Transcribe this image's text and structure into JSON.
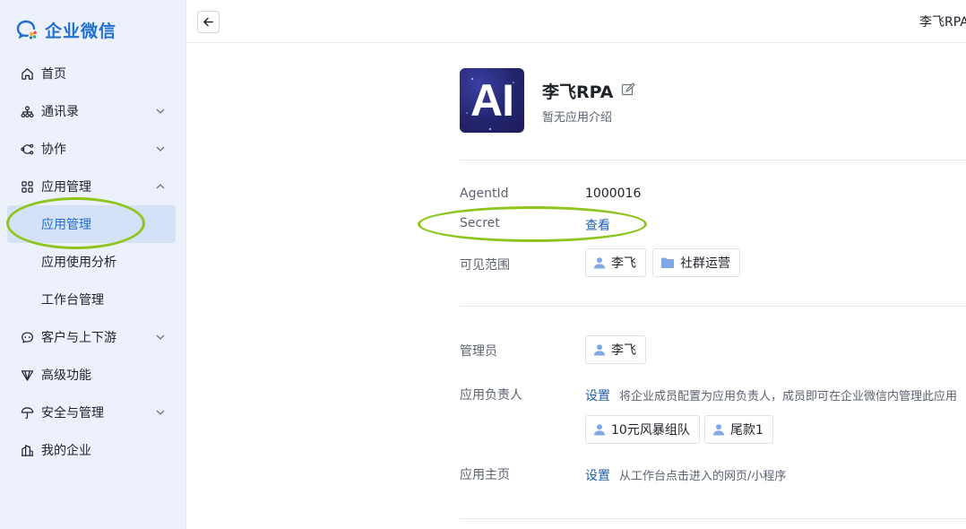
{
  "brand": {
    "name": "企业微信"
  },
  "sidebar": {
    "items": [
      {
        "label": "首页"
      },
      {
        "label": "通讯录"
      },
      {
        "label": "协作"
      },
      {
        "label": "应用管理"
      },
      {
        "label": "客户与上下游"
      },
      {
        "label": "高级功能"
      },
      {
        "label": "安全与管理"
      },
      {
        "label": "我的企业"
      }
    ],
    "subitems": [
      {
        "label": "应用管理"
      },
      {
        "label": "应用使用分析"
      },
      {
        "label": "工作台管理"
      }
    ]
  },
  "header": {
    "title": "李飞RPA"
  },
  "app": {
    "icon_text": "AI",
    "name": "李飞RPA",
    "description": "暂无应用介绍"
  },
  "details": {
    "agentid_label": "AgentId",
    "agentid_value": "1000016",
    "secret_label": "Secret",
    "secret_link": "查看",
    "visibility_label": "可见范围",
    "visibility_tags": [
      {
        "label": "李飞"
      },
      {
        "label": "社群运营"
      }
    ]
  },
  "management": {
    "admin_label": "管理员",
    "admin_tags": [
      {
        "label": "李飞"
      }
    ],
    "owner_label": "应用负责人",
    "owner_link": "设置",
    "owner_hint": "将企业成员配置为应用负责人，成员即可在企业微信内管理此应用",
    "owner_tags": [
      {
        "label": "10元风暴组队"
      },
      {
        "label": "尾款1"
      }
    ],
    "homepage_label": "应用主页",
    "homepage_link": "设置",
    "homepage_hint": "从工作台点击进入的网页/小程序"
  },
  "colors": {
    "accent": "#1f6fd1",
    "link": "#1f5fb4",
    "highlight": "#8ec51e",
    "sidebar_bg": "#edf1fb"
  }
}
